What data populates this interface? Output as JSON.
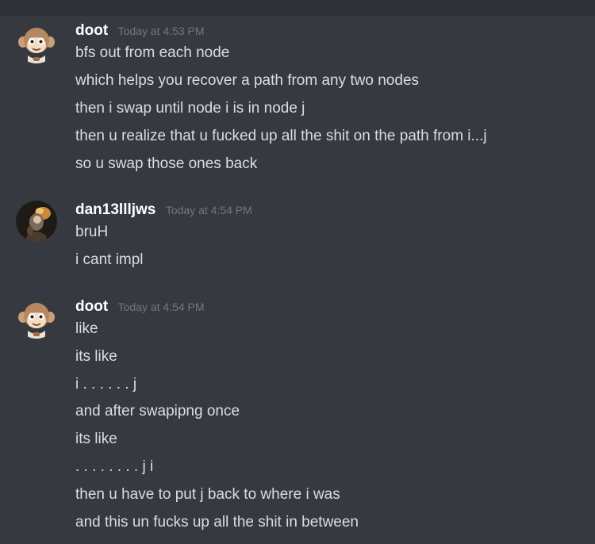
{
  "messages": [
    {
      "username": "doot",
      "avatar_icon": "monkey-avatar-icon",
      "timestamp": "Today at 4:53 PM",
      "lines": [
        "bfs out from each node",
        "which helps you recover a path from any two nodes",
        "then i swap until node i is in node j",
        "then u realize that u fucked up all the shit on the path from i...j",
        "so u swap those ones back"
      ]
    },
    {
      "username": "dan13llljws",
      "avatar_icon": "character-avatar-icon",
      "timestamp": "Today at 4:54 PM",
      "lines": [
        "bruH",
        "i cant impl"
      ]
    },
    {
      "username": "doot",
      "avatar_icon": "monkey-avatar-icon",
      "timestamp": "Today at 4:54 PM",
      "lines": [
        "like",
        "its like",
        "i . . . . . . j",
        "and after swapipng once",
        "its like",
        ". . . . . . . . j i",
        "then u have to put j back to where i was",
        "and this un fucks up all the shit in between"
      ]
    }
  ],
  "colors": {
    "background": "#36393f",
    "username": "#ffffff",
    "timestamp": "#72767d",
    "text": "#dcddde"
  }
}
